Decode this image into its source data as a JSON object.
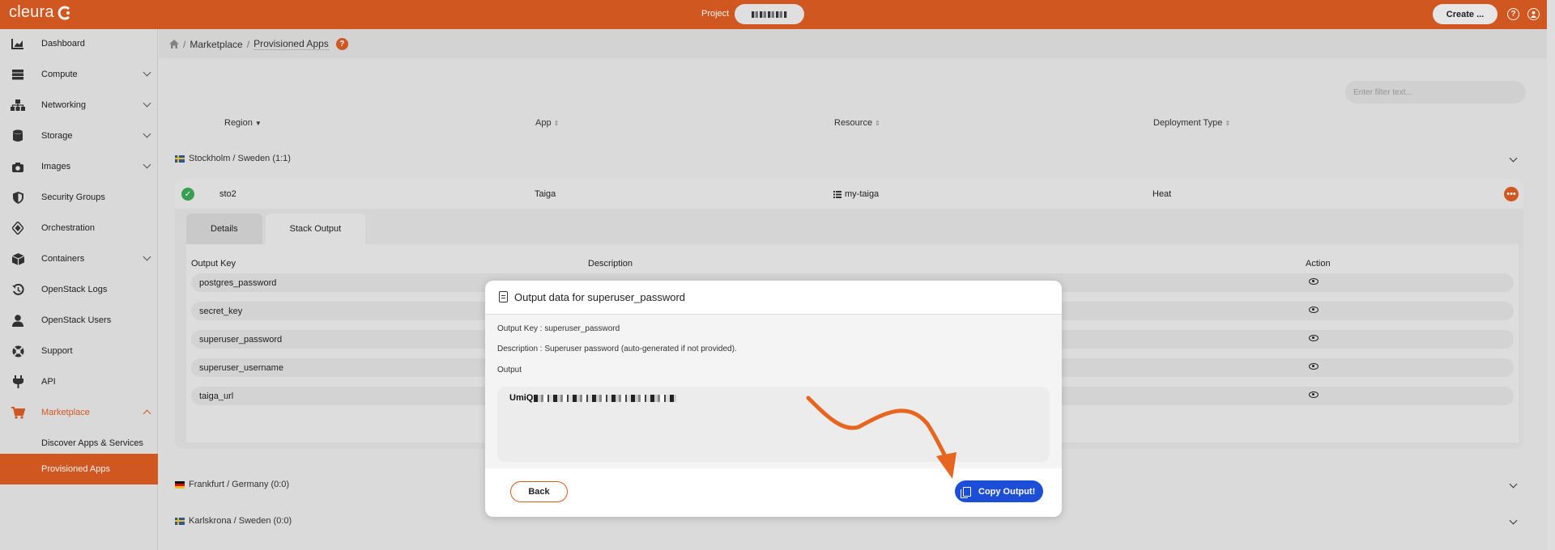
{
  "app": {
    "brand": "cleura",
    "project_label": "Project",
    "create_label": "Create ...",
    "help_glyph": "?",
    "accent": "#d95b22"
  },
  "sidebar": {
    "items": [
      {
        "label": "Dashboard",
        "icon": "chart-icon"
      },
      {
        "label": "Compute",
        "icon": "server-icon"
      },
      {
        "label": "Networking",
        "icon": "network-icon"
      },
      {
        "label": "Storage",
        "icon": "database-icon"
      },
      {
        "label": "Images",
        "icon": "camera-icon"
      },
      {
        "label": "Security Groups",
        "icon": "shield-icon"
      },
      {
        "label": "Orchestration",
        "icon": "layers-icon"
      },
      {
        "label": "Containers",
        "icon": "cube-icon"
      },
      {
        "label": "OpenStack Logs",
        "icon": "history-icon"
      },
      {
        "label": "OpenStack Users",
        "icon": "user-icon"
      },
      {
        "label": "Support",
        "icon": "lifebuoy-icon"
      },
      {
        "label": "API",
        "icon": "plug-icon"
      },
      {
        "label": "Marketplace",
        "icon": "cart-icon"
      }
    ],
    "sub_items": [
      "Discover Apps & Services",
      "Provisioned Apps"
    ]
  },
  "breadcrumb": {
    "home": "home-icon",
    "section": "Marketplace",
    "page": "Provisioned Apps",
    "help": "?"
  },
  "filter": {
    "placeholder": "Enter filter text..."
  },
  "table": {
    "headers": [
      "Region",
      "App",
      "Resource",
      "Deployment Type"
    ],
    "groups": [
      "Stockholm / Sweden (1:1)",
      "Frankfurt / Germany (0:0)",
      "Karlskrona / Sweden (0:0)"
    ],
    "row": {
      "region": "sto2",
      "app": "Taiga",
      "resource": "my-taiga",
      "deployment_type": "Heat",
      "status_color": "#3aa655"
    }
  },
  "tabs": [
    "Details",
    "Stack Output"
  ],
  "outputs": {
    "headers": {
      "key": "Output Key",
      "description": "Description",
      "action": "Action"
    },
    "keys": [
      "postgres_password",
      "secret_key",
      "superuser_password",
      "superuser_username",
      "taiga_url"
    ]
  },
  "modal": {
    "title": "Output data for superuser_password",
    "output_key_line": "Output Key : superuser_password",
    "description_line": "Description : Superuser password (auto-generated if not provided).",
    "output_label": "Output",
    "output_value": "UmiQ",
    "back_label": "Back",
    "copy_label": "Copy Output!",
    "copy_color": "#1d4ed8"
  }
}
